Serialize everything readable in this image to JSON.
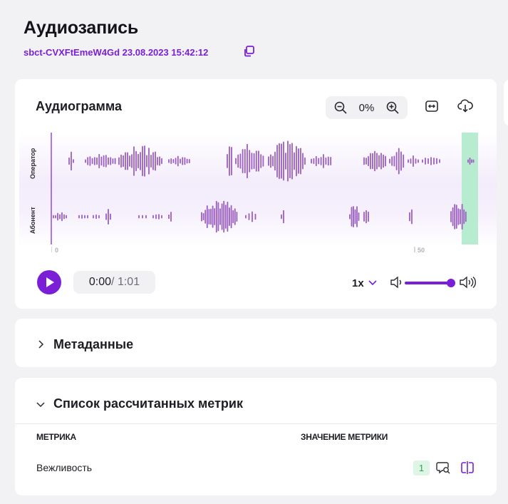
{
  "page": {
    "title": "Аудиозапись",
    "record_id": "sbct-CVXFtEmeW4Gd 23.08.2023 15:42:12"
  },
  "audiogram": {
    "title": "Аудиограмма",
    "zoom": "0%",
    "lanes": {
      "operator": "Оператор",
      "subscriber": "Абонент"
    },
    "ticks": [
      "0",
      "50"
    ],
    "accent": "#7a1fd6",
    "wave_color": "#9b5fc0",
    "highlight_color": "#b8ecd0"
  },
  "player": {
    "current": "0:00",
    "separator": "/",
    "total": "1:01",
    "speed": "1x"
  },
  "metadata": {
    "title": "Метаданные"
  },
  "metrics": {
    "title": "Список рассчитанных метрик",
    "columns": [
      "МЕТРИКА",
      "ЗНАЧЕНИЕ МЕТРИКИ"
    ],
    "rows": [
      {
        "name": "Вежливость",
        "value": "1"
      }
    ]
  }
}
